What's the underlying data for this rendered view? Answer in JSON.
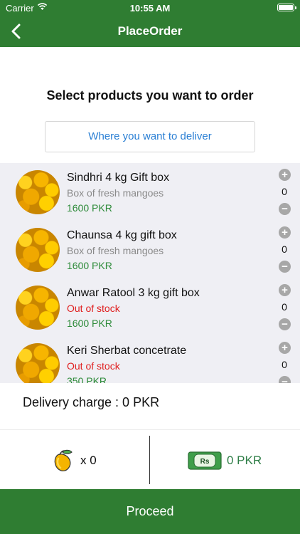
{
  "status_bar": {
    "carrier": "Carrier",
    "time": "10:55 AM"
  },
  "nav": {
    "title": "PlaceOrder"
  },
  "prompt": "Select products you want to order",
  "deliver_button": "Where you want to deliver",
  "products": [
    {
      "name": "Sindhri 4 kg Gift box",
      "status": "Box of fresh mangoes",
      "out_of_stock": false,
      "price": "1600 PKR",
      "quantity": "0"
    },
    {
      "name": "Chaunsa 4 kg gift box",
      "status": "Box of fresh mangoes",
      "out_of_stock": false,
      "price": "1600 PKR",
      "quantity": "0"
    },
    {
      "name": "Anwar Ratool 3 kg gift box",
      "status": "Out of stock",
      "out_of_stock": true,
      "price": "1600 PKR",
      "quantity": "0"
    },
    {
      "name": "Keri Sherbat concetrate",
      "status": "Out of stock",
      "out_of_stock": true,
      "price": "350 PKR",
      "quantity": "0"
    }
  ],
  "delivery_charge": "Delivery charge : 0 PKR",
  "summary": {
    "count": "x 0",
    "currency_badge": "Rs",
    "total": "0 PKR"
  },
  "proceed_label": "Proceed",
  "icons": {
    "back": "chevron-left-icon",
    "wifi": "wifi-icon",
    "battery": "battery-icon",
    "plus": "plus-circle-icon",
    "minus": "minus-circle-icon",
    "mango": "mango-icon",
    "rupee": "rupee-note-icon"
  },
  "colors": {
    "brand_green": "#2f7d32",
    "price_green": "#2e8b3a",
    "out_of_stock_red": "#e02020",
    "link_blue": "#2a7fd4"
  }
}
